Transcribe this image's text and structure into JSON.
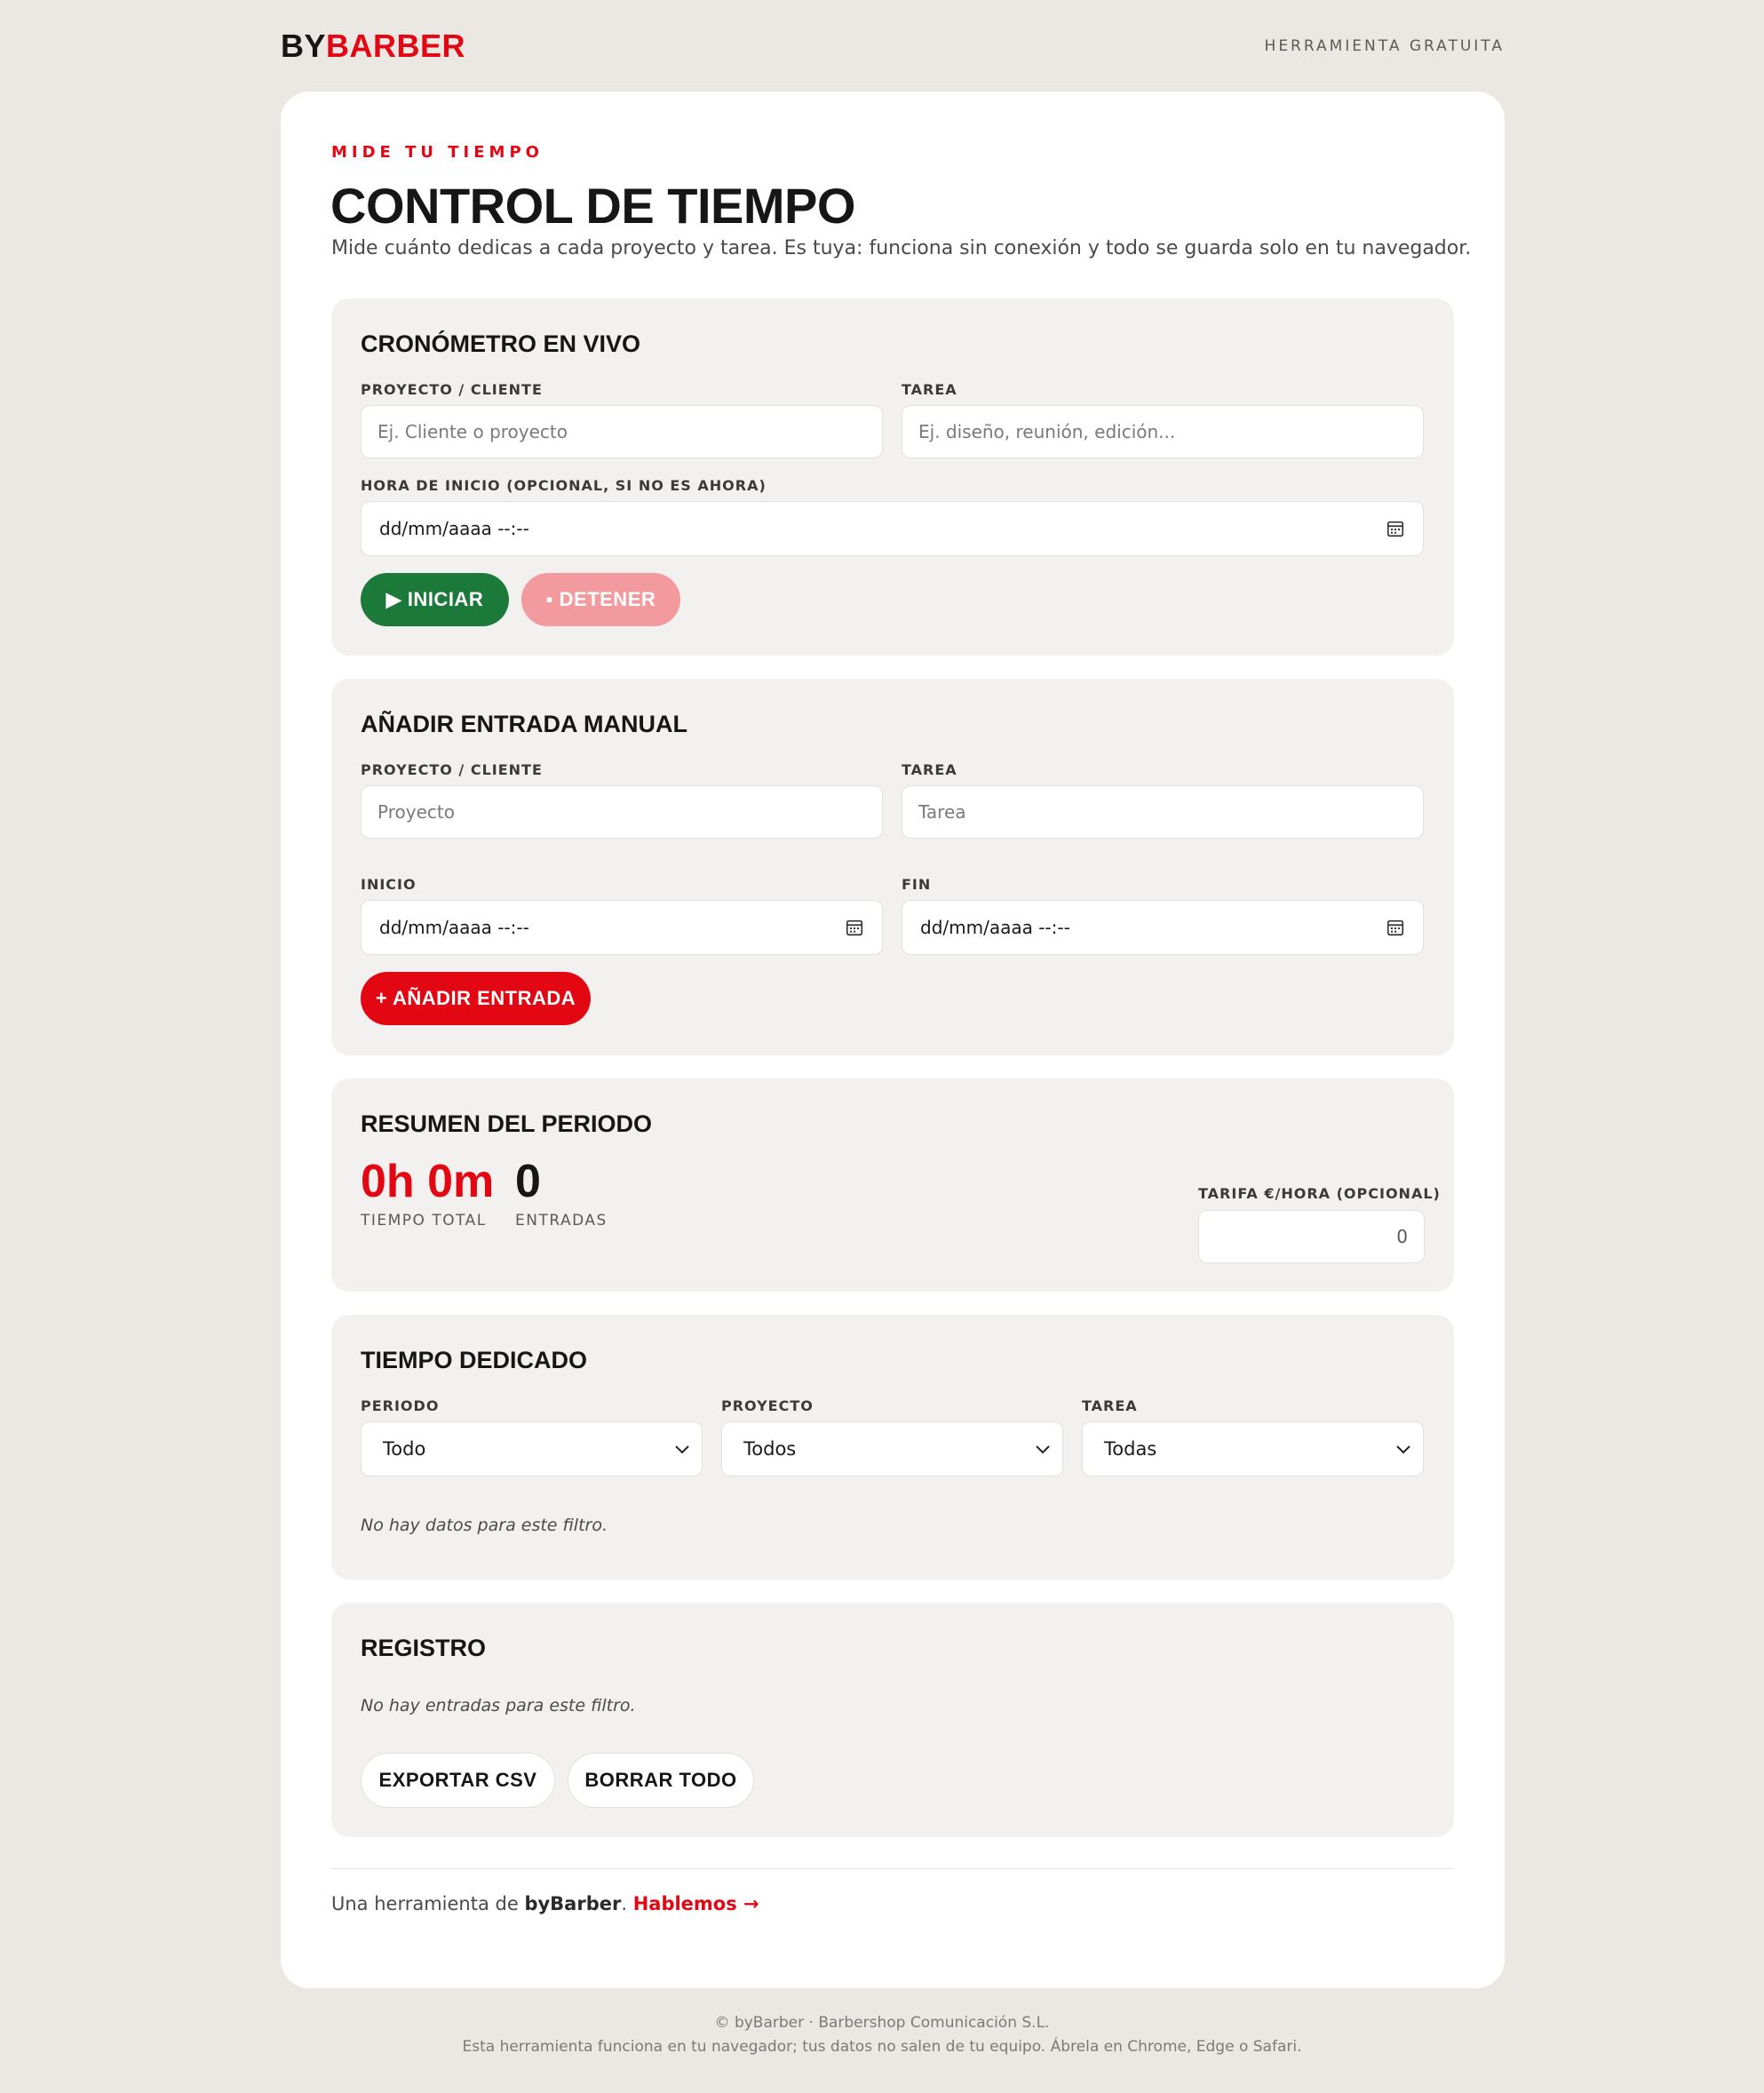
{
  "header": {
    "logo_part1": "BY",
    "logo_part2": "BARBER",
    "tag": "HERRAMIENTA GRATUITA"
  },
  "intro": {
    "eyebrow": "MIDE TU TIEMPO",
    "title": "CONTROL DE TIEMPO",
    "subtitle": "Mide cuánto dedicas a cada proyecto y tarea. Es tuya: funciona sin conexión y todo se guarda solo en tu navegador."
  },
  "live_timer": {
    "title": "CRONÓMETRO EN VIVO",
    "project_label": "PROYECTO / CLIENTE",
    "project_placeholder": "Ej. Cliente o proyecto",
    "task_label": "TAREA",
    "task_placeholder": "Ej. diseño, reunión, edición...",
    "start_label": "HORA DE INICIO (OPCIONAL, SI NO ES AHORA)",
    "start_value": "dd/mm/aaaa  --:--",
    "start_button": "▶ INICIAR",
    "stop_button": "▪ DETENER"
  },
  "manual_entry": {
    "title": "AÑADIR ENTRADA MANUAL",
    "project_label": "PROYECTO / CLIENTE",
    "project_placeholder": "Proyecto",
    "task_label": "TAREA",
    "task_placeholder": "Tarea",
    "start_label": "INICIO",
    "start_value": "dd/mm/aaaa  --:--",
    "end_label": "FIN",
    "end_value": "dd/mm/aaaa  --:--",
    "add_button": "+ AÑADIR ENTRADA"
  },
  "summary": {
    "title": "RESUMEN DEL PERIODO",
    "total_time": "0h 0m",
    "total_time_label": "TIEMPO TOTAL",
    "entries": "0",
    "entries_label": "ENTRADAS",
    "rate_label": "TARIFA €/HORA (OPCIONAL)",
    "rate_value": "0"
  },
  "time_spent": {
    "title": "TIEMPO DEDICADO",
    "period_label": "PERIODO",
    "period_value": "Todo",
    "project_label": "PROYECTO",
    "project_value": "Todos",
    "task_label": "TAREA",
    "task_value": "Todas",
    "empty_text": "No hay datos para este filtro."
  },
  "log": {
    "title": "REGISTRO",
    "empty_text": "No hay entradas para este filtro.",
    "export_button": "EXPORTAR CSV",
    "clear_button": "BORRAR TODO"
  },
  "card_footer": {
    "prefix": "Una herramienta de ",
    "brand": "byBarber",
    "separator": ". ",
    "cta": "Hablemos →"
  },
  "legal": {
    "line1": "© byBarber · Barbershop Comunicación S.L.",
    "line2": "Esta herramienta funciona en tu navegador; tus datos no salen de tu equipo. Ábrela en Chrome, Edge o Safari."
  },
  "colors": {
    "accent": "#e30613",
    "start_green": "#1b7a3a",
    "stop_pink": "#f29a9e",
    "page_bg": "#ebe8e3",
    "panel_bg": "#f2f1ef"
  }
}
